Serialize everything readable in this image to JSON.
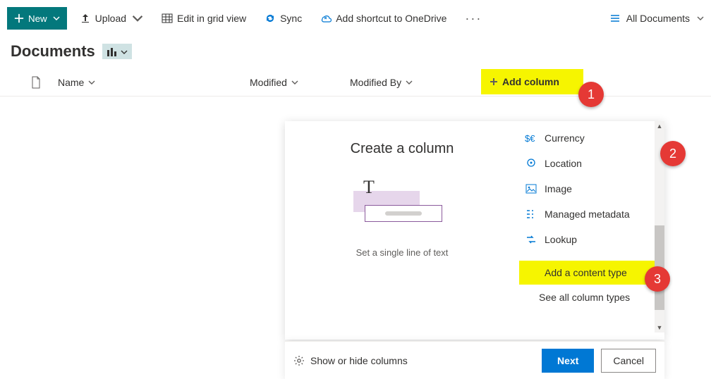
{
  "toolbar": {
    "new_label": "New",
    "upload_label": "Upload",
    "edit_grid_label": "Edit in grid view",
    "sync_label": "Sync",
    "shortcut_label": "Add shortcut to OneDrive",
    "view_label": "All Documents"
  },
  "page": {
    "title": "Documents"
  },
  "columns": {
    "name": "Name",
    "modified": "Modified",
    "modified_by": "Modified By",
    "add_column": "Add column"
  },
  "panel": {
    "title": "Create a column",
    "subtitle": "Set a single line of text",
    "types": {
      "currency": "Currency",
      "location": "Location",
      "image": "Image",
      "managed_metadata": "Managed metadata",
      "lookup": "Lookup",
      "add_content_type": "Add a content type",
      "see_all": "See all column types"
    }
  },
  "footer": {
    "show_hide": "Show or hide columns",
    "next": "Next",
    "cancel": "Cancel"
  },
  "callouts": {
    "c1": "1",
    "c2": "2",
    "c3": "3"
  }
}
